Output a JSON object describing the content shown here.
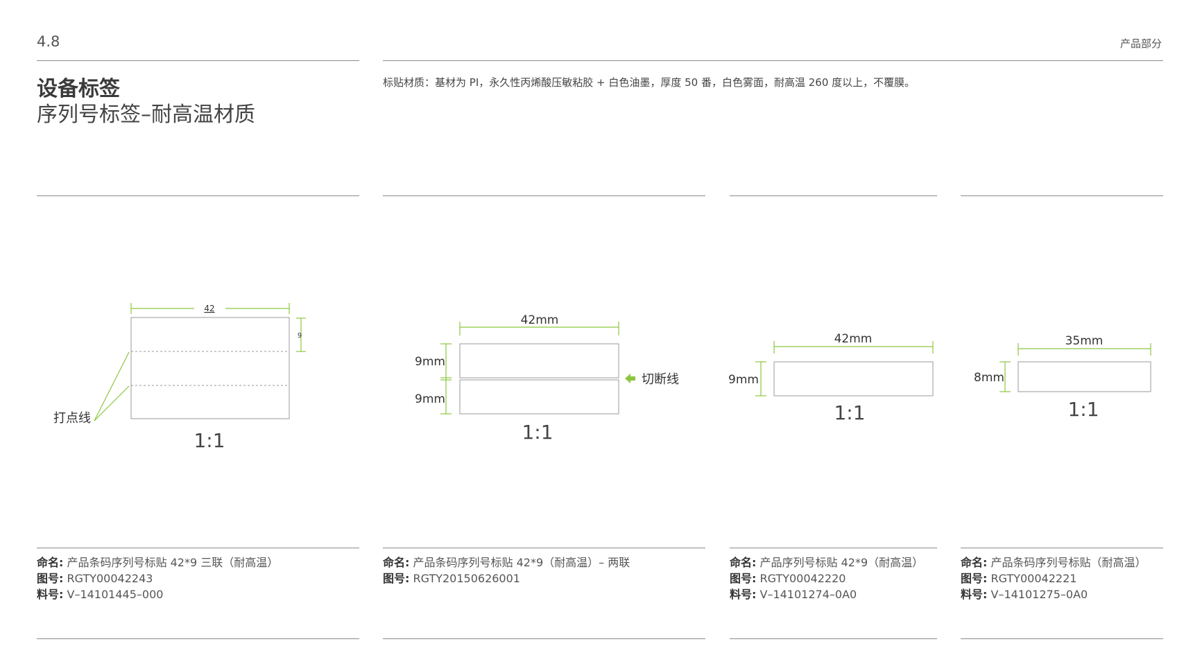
{
  "header": {
    "page_number": "4.8",
    "section_label": "产品部分",
    "title_main": "设备标签",
    "title_sub": "序列号标签–耐高温材质",
    "material_note": "标贴材质：基材为 PI，永久性丙烯酸压敏粘胶 + 白色油墨，厚度 50 番，白色雾面，耐高温 260 度以上，不覆膜。"
  },
  "colors": {
    "accent_green": "#8cc63f",
    "rule_gray": "#8a8a8a",
    "outline_gray": "#999999"
  },
  "labels": [
    {
      "width_dim": "42",
      "height_dim": "9",
      "callout": "打点线",
      "scale": "1:1",
      "info": {
        "name_key": "命名:",
        "name_val": "产品条码序列号标贴 42*9 三联（耐高温）",
        "drawing_key": "图号:",
        "drawing_val": "RGTY00042243",
        "part_key": "料号:",
        "part_val": "V–14101445–000"
      }
    },
    {
      "width_dim": "42mm",
      "height_dim_top": "9mm",
      "height_dim_bottom": "9mm",
      "callout": "切断线",
      "callout_icon": "arrow-left-icon",
      "scale": "1:1",
      "info": {
        "name_key": "命名:",
        "name_val": "产品条码序列号标贴 42*9（耐高温）– 两联",
        "drawing_key": "图号:",
        "drawing_val": "RGTY20150626001"
      }
    },
    {
      "width_dim": "42mm",
      "height_dim": "9mm",
      "scale": "1:1",
      "info": {
        "name_key": "命名:",
        "name_val": "产品序列号标贴 42*9（耐高温）",
        "drawing_key": "图号:",
        "drawing_val": "RGTY00042220",
        "part_key": "料号:",
        "part_val": "V–14101274–0A0"
      }
    },
    {
      "width_dim": "35mm",
      "height_dim": "8mm",
      "scale": "1:1",
      "info": {
        "name_key": "命名:",
        "name_val": "产品条码序列号标贴（耐高温）",
        "drawing_key": "图号:",
        "drawing_val": "RGTY00042221",
        "part_key": "料号:",
        "part_val": "V–14101275–0A0"
      }
    }
  ]
}
